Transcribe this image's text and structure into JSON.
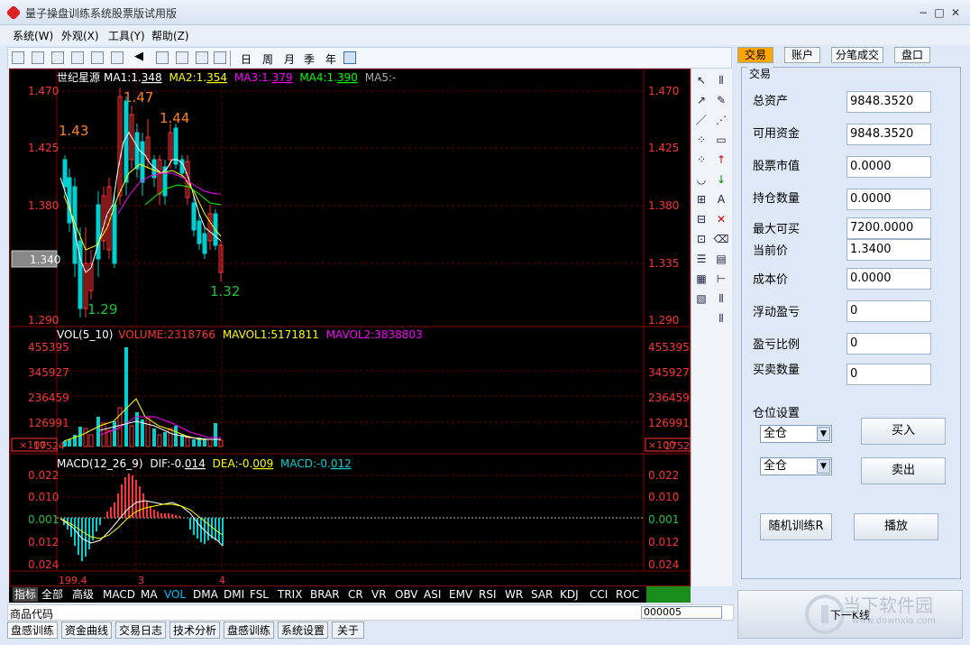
{
  "window": {
    "title": "量子操盘训练系统股票版试用版",
    "min": "−",
    "max": "□",
    "close": "✕"
  },
  "menu": [
    "系统(W)",
    "外观(X)",
    "工具(Y)",
    "帮助(Z)"
  ],
  "toolbar": {
    "periods": [
      "日",
      "周",
      "月",
      "季",
      "年"
    ]
  },
  "chart": {
    "stock_name": "世纪星源",
    "ma": {
      "ma1_label": "MA1:1.",
      "ma1_val": "348",
      "ma2_label": "MA2:1.",
      "ma2_val": "354",
      "ma3_label": "MA3:1.",
      "ma3_val": "379",
      "ma4_label": "MA4:1.",
      "ma4_val": "390",
      "ma5_label": "MA5:-"
    },
    "price_axis": [
      "1.470",
      "1.425",
      "1.380",
      "1.335",
      "1.290"
    ],
    "current_price_tag": "1.340",
    "annotations": {
      "high1": "1.47",
      "high_left": "1.43",
      "high2": "1.44",
      "low1": "1.29",
      "low2": "1.32"
    },
    "vol_header": {
      "label": "VOL(5_10)",
      "volume": "VOLUME:2318766",
      "mavol1": "MAVOL1:5171811",
      "mavol2": "MAVOL2:3838803"
    },
    "vol_axis": [
      "455395",
      "345927",
      "236459",
      "126991"
    ],
    "vol_unit_tag": "×100",
    "vol_last": "17524",
    "macd_header": {
      "label": "MACD(12_26_9)",
      "dif_label": "DIF:-0.",
      "dif_val": "014",
      "dea_label": "DEA:-0.",
      "dea_val": "009",
      "macd_label": "MACD:-0.",
      "macd_val": "012"
    },
    "macd_axis": [
      "0.022",
      "0.010",
      "0.001",
      "0.012",
      "0.024"
    ],
    "date_labels": [
      "199.4",
      "3",
      "4"
    ]
  },
  "indicators": [
    "指标",
    "全部",
    "高级",
    "MACD",
    "MA",
    "VOL",
    "DMA",
    "DMI",
    "FSL",
    "TRIX",
    "BRAR",
    "CR",
    "VR",
    "OBV",
    "ASI",
    "EMV",
    "RSI",
    "WR",
    "SAR",
    "KDJ",
    "CCI",
    "ROC"
  ],
  "active_indicator": "VOL",
  "status": {
    "code_label": "商品代码",
    "code_value": "000005"
  },
  "bottom_tabs": [
    "盘感训练",
    "资金曲线",
    "交易日志",
    "技术分析",
    "盘感训练",
    "系统设置",
    "关于"
  ],
  "side_tabs": [
    "交易",
    "账户",
    "分笔成交",
    "盘口"
  ],
  "panel": {
    "section": "交易",
    "fields": [
      {
        "label": "总资产",
        "value": "9848.3520"
      },
      {
        "label": "可用资金",
        "value": "9848.3520"
      },
      {
        "label": "股票市值",
        "value": "0.0000"
      },
      {
        "label": "持仓数量",
        "value": "0.0000"
      },
      {
        "label": "最大可买",
        "value": "7200.0000"
      },
      {
        "label": "当前价",
        "value": "1.3400"
      },
      {
        "label": "成本价",
        "value": "0.0000"
      },
      {
        "label": "浮动盈亏",
        "value": "0"
      },
      {
        "label": "盈亏比例",
        "value": "0"
      },
      {
        "label": "买卖数量",
        "value": "0"
      }
    ],
    "position_label": "仓位设置",
    "select1": "全仓",
    "select2": "全仓",
    "buy": "买入",
    "sell": "卖出",
    "random_train": "随机训练R",
    "play": "播放",
    "next_kline": "下一K线"
  },
  "watermark": {
    "line1": "当下软件园",
    "line2": "www.downxia.com"
  },
  "colors": {
    "up": "#ff3333",
    "down": "#00d0d0",
    "ma1": "#ffffff",
    "ma2": "#ffff00",
    "ma3": "#ff00ff",
    "ma4": "#00ff00"
  }
}
